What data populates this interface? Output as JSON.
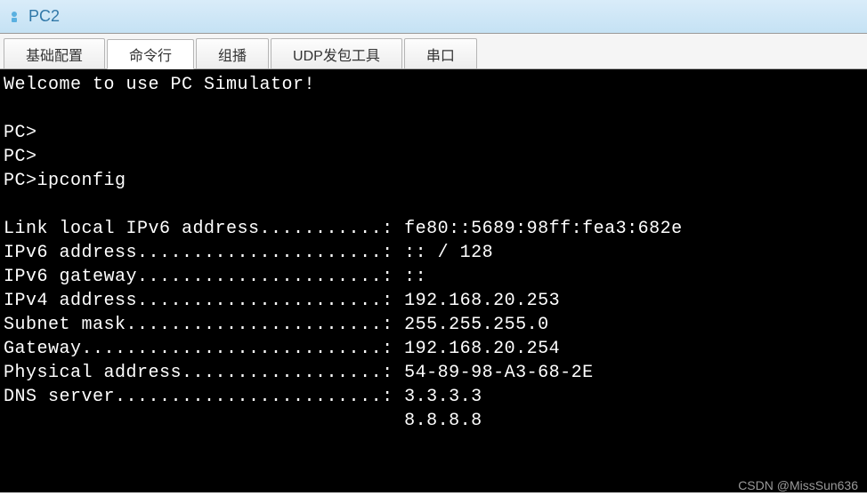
{
  "window": {
    "title": "PC2"
  },
  "tabs": {
    "basic": "基础配置",
    "cmd": "命令行",
    "multicast": "组播",
    "udp": "UDP发包工具",
    "serial": "串口"
  },
  "terminal": {
    "welcome": "Welcome to use PC Simulator!",
    "prompt1": "PC>",
    "prompt2": "PC>",
    "prompt3": "PC>ipconfig",
    "line_ipv6_local": "Link local IPv6 address...........: fe80::5689:98ff:fea3:682e",
    "line_ipv6_addr": "IPv6 address......................: :: / 128",
    "line_ipv6_gw": "IPv6 gateway......................: ::",
    "line_ipv4_addr": "IPv4 address......................: 192.168.20.253",
    "line_subnet": "Subnet mask.......................: 255.255.255.0",
    "line_gateway": "Gateway...........................: 192.168.20.254",
    "line_physical": "Physical address..................: 54-89-98-A3-68-2E",
    "line_dns1": "DNS server........................: 3.3.3.3",
    "line_dns2": "                                    8.8.8.8"
  },
  "watermark": "CSDN @MissSun636"
}
